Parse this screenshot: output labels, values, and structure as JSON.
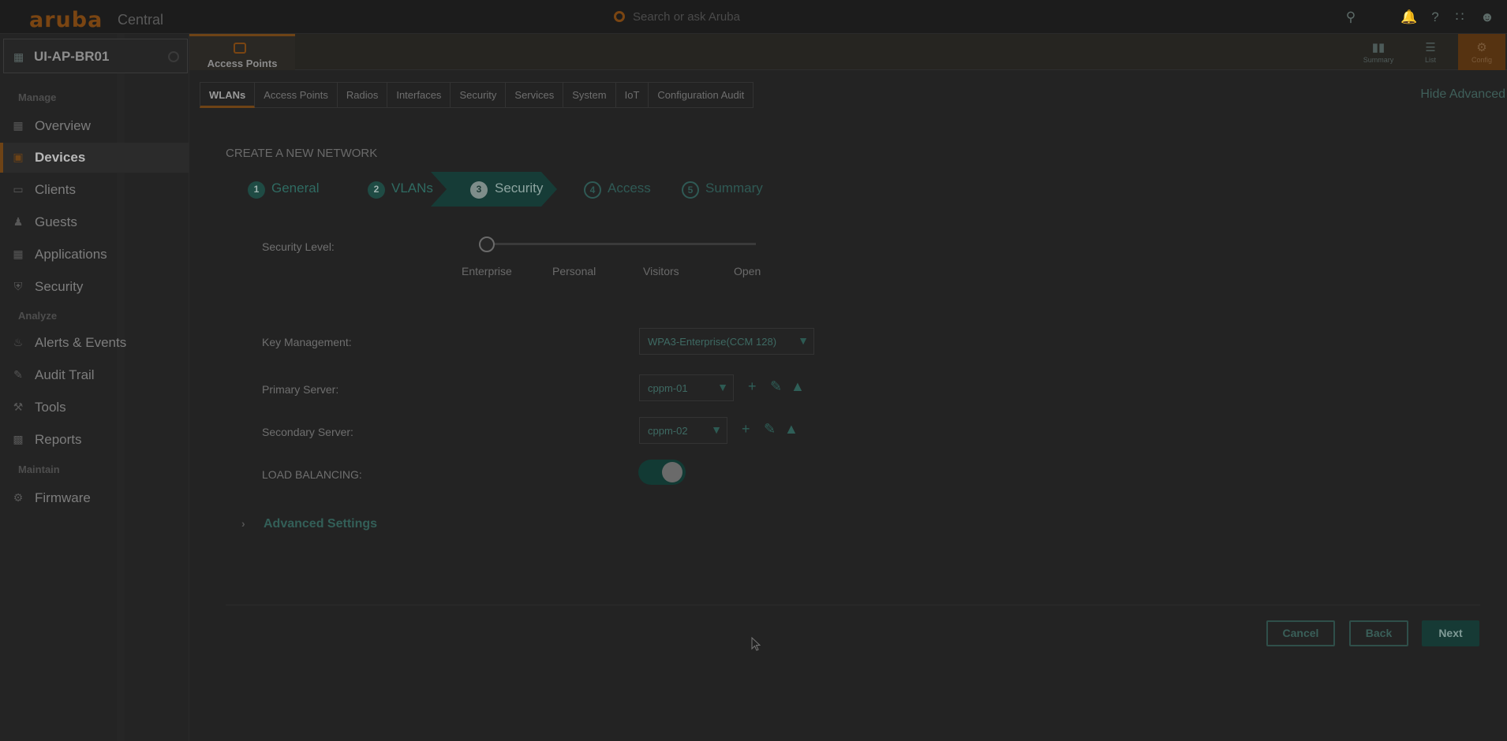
{
  "header": {
    "logo": "aruba",
    "logo_sub": "Central",
    "search_placeholder": "Search or ask Aruba"
  },
  "sidebar": {
    "context_name": "UI-AP-BR01",
    "sections": {
      "manage": "Manage",
      "analyze": "Analyze",
      "maintain": "Maintain"
    },
    "items": [
      {
        "label": "Overview",
        "icon": "grid-icon"
      },
      {
        "label": "Devices",
        "icon": "devices-icon",
        "active": true
      },
      {
        "label": "Clients",
        "icon": "clients-icon"
      },
      {
        "label": "Guests",
        "icon": "guests-icon"
      },
      {
        "label": "Applications",
        "icon": "applications-icon"
      },
      {
        "label": "Security",
        "icon": "shield-icon"
      },
      {
        "label": "Alerts & Events",
        "icon": "bell-icon"
      },
      {
        "label": "Audit Trail",
        "icon": "audit-icon"
      },
      {
        "label": "Tools",
        "icon": "wrench-icon"
      },
      {
        "label": "Reports",
        "icon": "reports-icon"
      },
      {
        "label": "Firmware",
        "icon": "firmware-icon"
      }
    ]
  },
  "device_tab": {
    "label": "Access Points"
  },
  "view_buttons": {
    "summary": "Summary",
    "list": "List",
    "config": "Config"
  },
  "subtabs": [
    "WLANs",
    "Access Points",
    "Radios",
    "Interfaces",
    "Security",
    "Services",
    "System",
    "IoT",
    "Configuration Audit"
  ],
  "hide_advanced": "Hide Advanced",
  "wizard": {
    "title": "CREATE A NEW NETWORK",
    "steps": [
      {
        "num": "1",
        "label": "General"
      },
      {
        "num": "2",
        "label": "VLANs"
      },
      {
        "num": "3",
        "label": "Security"
      },
      {
        "num": "4",
        "label": "Access"
      },
      {
        "num": "5",
        "label": "Summary"
      }
    ]
  },
  "form": {
    "security_level_label": "Security Level:",
    "security_levels": [
      "Enterprise",
      "Personal",
      "Visitors",
      "Open"
    ],
    "security_level_value": "Enterprise",
    "key_management_label": "Key Management:",
    "key_management_value": "WPA3-Enterprise(CCM 128)",
    "primary_server_label": "Primary Server:",
    "primary_server_value": "cppm-01",
    "secondary_server_label": "Secondary Server:",
    "secondary_server_value": "cppm-02",
    "load_balancing_label": "LOAD BALANCING:",
    "load_balancing_on": true,
    "advanced_settings": "Advanced Settings"
  },
  "buttons": {
    "cancel": "Cancel",
    "back": "Back",
    "next": "Next"
  },
  "colors": {
    "accent": "#6e4316",
    "teal": "#163c37"
  }
}
